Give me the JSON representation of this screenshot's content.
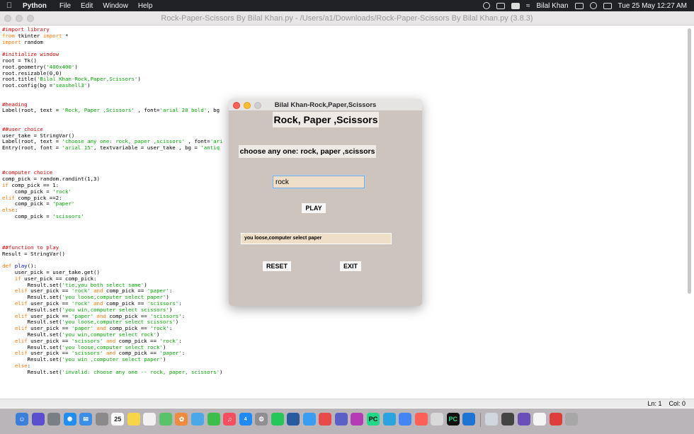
{
  "menubar": {
    "app_name": "Python",
    "items": [
      "File",
      "Edit",
      "Window",
      "Help"
    ],
    "user": "Bilal Khan",
    "datetime": "Tue 25 May  12:27 AM"
  },
  "editor": {
    "title": "Rock-Paper-Scissors By Bilal Khan.py - /Users/a1/Downloads/Rock-Paper-Scissors By Bilal Khan.py (3.8.3)",
    "code_lines": [
      [
        [
          "c",
          "#import library"
        ]
      ],
      [
        [
          "k",
          "from"
        ],
        [
          "n",
          " tkinter "
        ],
        [
          "k",
          "import"
        ],
        [
          "n",
          " *"
        ]
      ],
      [
        [
          "k",
          "import"
        ],
        [
          "n",
          " random"
        ]
      ],
      [
        [
          "n",
          ""
        ]
      ],
      [
        [
          "c",
          "#initialize window"
        ]
      ],
      [
        [
          "n",
          "root = Tk()"
        ]
      ],
      [
        [
          "n",
          "root.geometry("
        ],
        [
          "s",
          "'400x400'"
        ],
        [
          "n",
          ")"
        ]
      ],
      [
        [
          "n",
          "root.resizable(0,0)"
        ]
      ],
      [
        [
          "n",
          "root.title("
        ],
        [
          "s",
          "'Bilal Khan-Rock,Paper,Scissors'"
        ],
        [
          "n",
          ")"
        ]
      ],
      [
        [
          "n",
          "root.config(bg ="
        ],
        [
          "s",
          "'seashell3'"
        ],
        [
          "n",
          ")"
        ]
      ],
      [
        [
          "n",
          ""
        ]
      ],
      [
        [
          "n",
          ""
        ]
      ],
      [
        [
          "c",
          "#heading"
        ]
      ],
      [
        [
          "n",
          "Label(root, text = "
        ],
        [
          "s",
          "'Rock, Paper ,Scissors'"
        ],
        [
          "n",
          " , font="
        ],
        [
          "s",
          "'arial 20 bold'"
        ],
        [
          "n",
          ", bg"
        ]
      ],
      [
        [
          "n",
          ""
        ]
      ],
      [
        [
          "n",
          ""
        ]
      ],
      [
        [
          "c",
          "##user choice"
        ]
      ],
      [
        [
          "n",
          "user_take = StringVar()"
        ]
      ],
      [
        [
          "n",
          "Label(root, text = "
        ],
        [
          "s",
          "'choose any one: rock, paper ,scissors'"
        ],
        [
          "n",
          " , font="
        ],
        [
          "s",
          "'ari"
        ]
      ],
      [
        [
          "n",
          "Entry(root, font = "
        ],
        [
          "s",
          "'arial 15'"
        ],
        [
          "n",
          ", textvariable = user_take , bg = "
        ],
        [
          "s",
          "'antiq"
        ]
      ],
      [
        [
          "n",
          ""
        ]
      ],
      [
        [
          "n",
          ""
        ]
      ],
      [
        [
          "n",
          ""
        ]
      ],
      [
        [
          "c",
          "#computer choice"
        ]
      ],
      [
        [
          "n",
          "comp_pick = random.randint(1,3)"
        ]
      ],
      [
        [
          "k",
          "if"
        ],
        [
          "n",
          " comp_pick == 1:"
        ]
      ],
      [
        [
          "n",
          "    comp_pick = "
        ],
        [
          "s",
          "'rock'"
        ]
      ],
      [
        [
          "k",
          "elif"
        ],
        [
          "n",
          " comp_pick ==2:"
        ]
      ],
      [
        [
          "n",
          "    comp_pick = "
        ],
        [
          "s",
          "'paper'"
        ]
      ],
      [
        [
          "k",
          "else"
        ],
        [
          "n",
          ":"
        ]
      ],
      [
        [
          "n",
          "    comp_pick = "
        ],
        [
          "s",
          "'scissors'"
        ]
      ],
      [
        [
          "n",
          ""
        ]
      ],
      [
        [
          "n",
          ""
        ]
      ],
      [
        [
          "n",
          ""
        ]
      ],
      [
        [
          "n",
          ""
        ]
      ],
      [
        [
          "c",
          "##function to play"
        ]
      ],
      [
        [
          "n",
          "Result = StringVar()"
        ]
      ],
      [
        [
          "n",
          ""
        ]
      ],
      [
        [
          "k",
          "def"
        ],
        [
          "d",
          " play"
        ],
        [
          "n",
          "():"
        ]
      ],
      [
        [
          "n",
          "    user_pick = user_take.get()"
        ]
      ],
      [
        [
          "n",
          "    "
        ],
        [
          "k",
          "if"
        ],
        [
          "n",
          " user_pick == comp_pick:"
        ]
      ],
      [
        [
          "n",
          "        Result.set("
        ],
        [
          "s",
          "'tie,you both select same'"
        ],
        [
          "n",
          ")"
        ]
      ],
      [
        [
          "n",
          "    "
        ],
        [
          "k",
          "elif"
        ],
        [
          "n",
          " user_pick == "
        ],
        [
          "s",
          "'rock'"
        ],
        [
          "n",
          " "
        ],
        [
          "k",
          "and"
        ],
        [
          "n",
          " comp_pick == "
        ],
        [
          "s",
          "'paper'"
        ],
        [
          "n",
          ":"
        ]
      ],
      [
        [
          "n",
          "        Result.set("
        ],
        [
          "s",
          "'you loose,computer select paper'"
        ],
        [
          "n",
          ")"
        ]
      ],
      [
        [
          "n",
          "    "
        ],
        [
          "k",
          "elif"
        ],
        [
          "n",
          " user_pick == "
        ],
        [
          "s",
          "'rock'"
        ],
        [
          "n",
          " "
        ],
        [
          "k",
          "and"
        ],
        [
          "n",
          " comp_pick == "
        ],
        [
          "s",
          "'scissors'"
        ],
        [
          "n",
          ":"
        ]
      ],
      [
        [
          "n",
          "        Result.set("
        ],
        [
          "s",
          "'you win,computer select scissors'"
        ],
        [
          "n",
          ")"
        ]
      ],
      [
        [
          "n",
          "    "
        ],
        [
          "k",
          "elif"
        ],
        [
          "n",
          " user_pick == "
        ],
        [
          "s",
          "'paper'"
        ],
        [
          "n",
          " "
        ],
        [
          "k",
          "and"
        ],
        [
          "n",
          " comp_pick == "
        ],
        [
          "s",
          "'scissors'"
        ],
        [
          "n",
          ":"
        ]
      ],
      [
        [
          "n",
          "        Result.set("
        ],
        [
          "s",
          "'you loose,computer select scissors'"
        ],
        [
          "n",
          ")"
        ]
      ],
      [
        [
          "n",
          "    "
        ],
        [
          "k",
          "elif"
        ],
        [
          "n",
          " user_pick == "
        ],
        [
          "s",
          "'paper'"
        ],
        [
          "n",
          " "
        ],
        [
          "k",
          "and"
        ],
        [
          "n",
          " comp_pick == "
        ],
        [
          "s",
          "'rock'"
        ],
        [
          "n",
          ":"
        ]
      ],
      [
        [
          "n",
          "        Result.set("
        ],
        [
          "s",
          "'you win,computer select rock'"
        ],
        [
          "n",
          ")"
        ]
      ],
      [
        [
          "n",
          "    "
        ],
        [
          "k",
          "elif"
        ],
        [
          "n",
          " user_pick == "
        ],
        [
          "s",
          "'scissors'"
        ],
        [
          "n",
          " "
        ],
        [
          "k",
          "and"
        ],
        [
          "n",
          " comp_pick == "
        ],
        [
          "s",
          "'rock'"
        ],
        [
          "n",
          ":"
        ]
      ],
      [
        [
          "n",
          "        Result.set("
        ],
        [
          "s",
          "'you loose,computer select rock'"
        ],
        [
          "n",
          ")"
        ]
      ],
      [
        [
          "n",
          "    "
        ],
        [
          "k",
          "elif"
        ],
        [
          "n",
          " user_pick == "
        ],
        [
          "s",
          "'scissors'"
        ],
        [
          "n",
          " "
        ],
        [
          "k",
          "and"
        ],
        [
          "n",
          " comp_pick == "
        ],
        [
          "s",
          "'paper'"
        ],
        [
          "n",
          ":"
        ]
      ],
      [
        [
          "n",
          "        Result.set("
        ],
        [
          "s",
          "'you win ,computer select paper'"
        ],
        [
          "n",
          ")"
        ]
      ],
      [
        [
          "n",
          "    "
        ],
        [
          "k",
          "else"
        ],
        [
          "n",
          ":"
        ]
      ],
      [
        [
          "n",
          "        Result.set("
        ],
        [
          "s",
          "'invalid: choose any one -- rock, paper, scissors'"
        ],
        [
          "n",
          ")"
        ]
      ]
    ],
    "status_ln": "Ln: 1",
    "status_col": "Col: 0"
  },
  "tk_window": {
    "title": "Bilal Khan-Rock,Paper,Scissors",
    "heading": "Rock, Paper ,Scissors",
    "prompt": "choose any one: rock, paper ,scissors",
    "entry_value": "rock",
    "play_label": "PLAY",
    "result": "you loose,computer select paper",
    "reset_label": "RESET",
    "exit_label": "EXIT"
  },
  "dock": {
    "calendar_day": "25",
    "app_store_badge": "4"
  }
}
